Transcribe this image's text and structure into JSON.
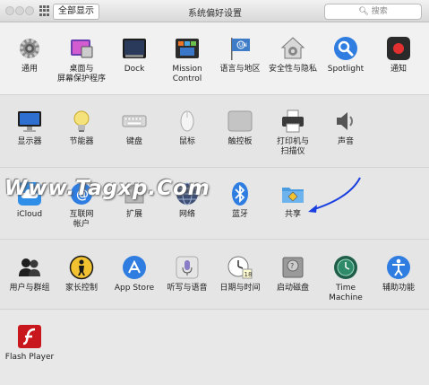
{
  "window": {
    "title": "系统偏好设置",
    "show_all_label": "全部显示",
    "search_placeholder": "搜索"
  },
  "watermark": "Www.Tagxp.Com",
  "sections": [
    {
      "panes": [
        {
          "label1": "通用",
          "label2": "",
          "icon": "general-gear-icon"
        },
        {
          "label1": "桌面与",
          "label2": "屏幕保护程序",
          "icon": "desktop-screensaver-icon"
        },
        {
          "label1": "Dock",
          "label2": "",
          "icon": "dock-icon"
        },
        {
          "label1": "Mission",
          "label2": "Control",
          "icon": "mission-control-icon"
        },
        {
          "label1": "语言与地区",
          "label2": "",
          "icon": "language-region-flag-icon"
        },
        {
          "label1": "安全性与隐私",
          "label2": "",
          "icon": "security-house-icon"
        },
        {
          "label1": "Spotlight",
          "label2": "",
          "icon": "spotlight-magnifier-icon"
        },
        {
          "label1": "通知",
          "label2": "",
          "icon": "notifications-icon"
        }
      ]
    },
    {
      "panes": [
        {
          "label1": "显示器",
          "label2": "",
          "icon": "displays-monitor-icon"
        },
        {
          "label1": "节能器",
          "label2": "",
          "icon": "energy-saver-bulb-icon"
        },
        {
          "label1": "键盘",
          "label2": "",
          "icon": "keyboard-icon"
        },
        {
          "label1": "鼠标",
          "label2": "",
          "icon": "mouse-icon"
        },
        {
          "label1": "触控板",
          "label2": "",
          "icon": "trackpad-icon"
        },
        {
          "label1": "打印机与",
          "label2": "扫描仪",
          "icon": "printer-icon"
        },
        {
          "label1": "声音",
          "label2": "",
          "icon": "sound-speaker-icon"
        }
      ]
    },
    {
      "panes": [
        {
          "label1": "iCloud",
          "label2": "",
          "icon": "icloud-icon"
        },
        {
          "label1": "互联网",
          "label2": "帐户",
          "icon": "internet-accounts-icon"
        },
        {
          "label1": "扩展",
          "label2": "",
          "icon": "extensions-puzzle-icon"
        },
        {
          "label1": "网络",
          "label2": "",
          "icon": "network-globe-icon"
        },
        {
          "label1": "蓝牙",
          "label2": "",
          "icon": "bluetooth-icon"
        },
        {
          "label1": "共享",
          "label2": "",
          "icon": "sharing-folder-icon"
        }
      ]
    },
    {
      "panes": [
        {
          "label1": "用户与群组",
          "label2": "",
          "icon": "users-groups-icon"
        },
        {
          "label1": "家长控制",
          "label2": "",
          "icon": "parental-controls-icon"
        },
        {
          "label1": "App Store",
          "label2": "",
          "icon": "app-store-icon"
        },
        {
          "label1": "听写与语音",
          "label2": "",
          "icon": "dictation-microphone-icon"
        },
        {
          "label1": "日期与时间",
          "label2": "",
          "icon": "date-time-clock-icon"
        },
        {
          "label1": "启动磁盘",
          "label2": "",
          "icon": "startup-disk-icon"
        },
        {
          "label1": "Time Machine",
          "label2": "",
          "icon": "time-machine-icon"
        },
        {
          "label1": "辅助功能",
          "label2": "",
          "icon": "accessibility-icon"
        }
      ]
    },
    {
      "panes": [
        {
          "label1": "Flash Player",
          "label2": "",
          "icon": "flash-player-icon"
        }
      ]
    }
  ]
}
